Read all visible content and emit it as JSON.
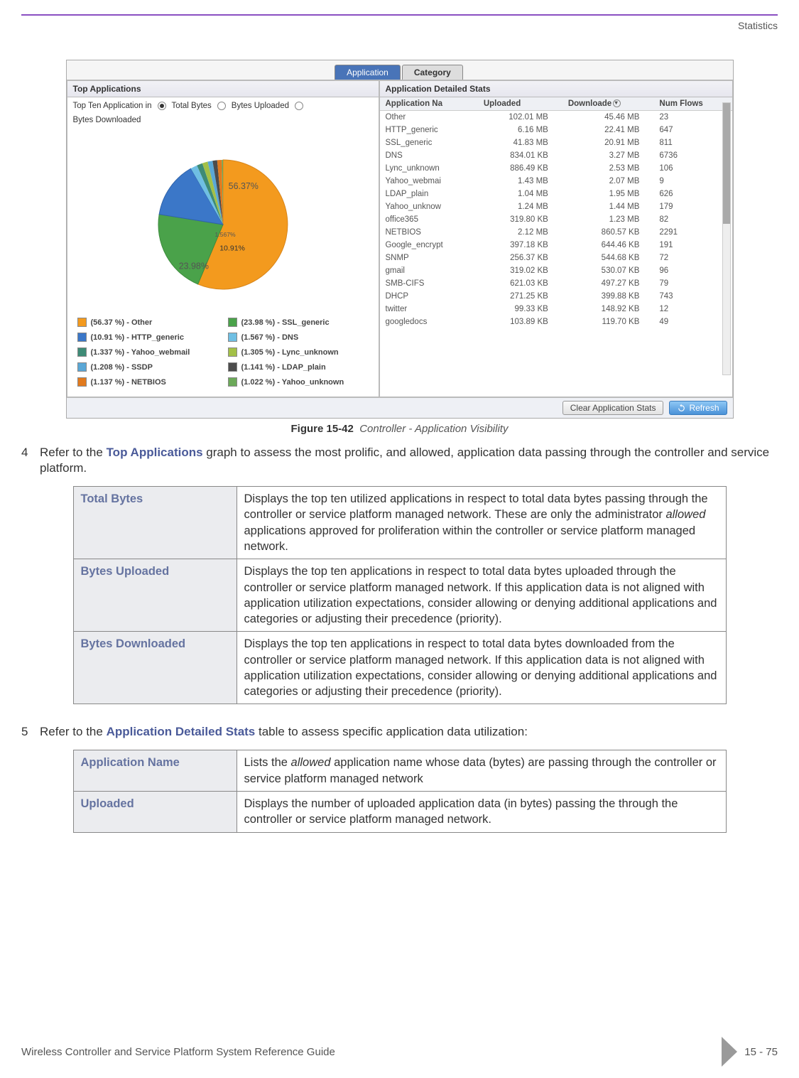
{
  "header": {
    "section": "Statistics"
  },
  "screenshot": {
    "tabs": {
      "active": "Application",
      "inactive": "Category"
    },
    "left_panel": {
      "title": "Top Applications",
      "radio_prefix": "Top Ten Application in",
      "radios": [
        {
          "label": "Total Bytes",
          "selected": true
        },
        {
          "label": "Bytes Uploaded",
          "selected": false
        },
        {
          "label": "Bytes Downloaded",
          "selected": false
        }
      ],
      "pie_labels": {
        "big": "56.37%",
        "mid2": "10.91%",
        "mid": "23.98%",
        "small": "1.567%"
      },
      "legend": [
        {
          "color": "#f39a1e",
          "text": "(56.37 %) - Other"
        },
        {
          "color": "#4aa24a",
          "text": "(23.98 %) - SSL_generic"
        },
        {
          "color": "#3b77c8",
          "text": "(10.91 %) - HTTP_generic"
        },
        {
          "color": "#6fbfe3",
          "text": "(1.567 %) - DNS"
        },
        {
          "color": "#3e8b76",
          "text": "(1.337 %) - Yahoo_webmail"
        },
        {
          "color": "#a3c047",
          "text": "(1.305 %) - Lync_unknown"
        },
        {
          "color": "#5aa7d6",
          "text": "(1.208 %) - SSDP"
        },
        {
          "color": "#4c4c4c",
          "text": "(1.141 %) - LDAP_plain"
        },
        {
          "color": "#e17a1e",
          "text": "(1.137 %) - NETBIOS"
        },
        {
          "color": "#6ca959",
          "text": "(1.022 %) - Yahoo_unknown"
        }
      ]
    },
    "right_panel": {
      "title": "Application Detailed Stats",
      "columns": [
        "Application Na",
        "Uploaded",
        "Downloade",
        "Num Flows"
      ],
      "rows": [
        [
          "Other",
          "102.01 MB",
          "45.46 MB",
          "23"
        ],
        [
          "HTTP_generic",
          "6.16 MB",
          "22.41 MB",
          "647"
        ],
        [
          "SSL_generic",
          "41.83 MB",
          "20.91 MB",
          "811"
        ],
        [
          "DNS",
          "834.01 KB",
          "3.27 MB",
          "6736"
        ],
        [
          "Lync_unknown",
          "886.49 KB",
          "2.53 MB",
          "106"
        ],
        [
          "Yahoo_webmai",
          "1.43 MB",
          "2.07 MB",
          "9"
        ],
        [
          "LDAP_plain",
          "1.04 MB",
          "1.95 MB",
          "626"
        ],
        [
          "Yahoo_unknow",
          "1.24 MB",
          "1.44 MB",
          "179"
        ],
        [
          "office365",
          "319.80 KB",
          "1.23 MB",
          "82"
        ],
        [
          "NETBIOS",
          "2.12 MB",
          "860.57 KB",
          "2291"
        ],
        [
          "Google_encrypt",
          "397.18 KB",
          "644.46 KB",
          "191"
        ],
        [
          "SNMP",
          "256.37 KB",
          "544.68 KB",
          "72"
        ],
        [
          "gmail",
          "319.02 KB",
          "530.07 KB",
          "96"
        ],
        [
          "SMB-CIFS",
          "621.03 KB",
          "497.27 KB",
          "79"
        ],
        [
          "DHCP",
          "271.25 KB",
          "399.88 KB",
          "743"
        ],
        [
          "twitter",
          "99.33 KB",
          "148.92 KB",
          "12"
        ],
        [
          "googledocs",
          "103.89 KB",
          "119.70 KB",
          "49"
        ]
      ],
      "buttons": {
        "clear": "Clear Application Stats",
        "refresh": "Refresh"
      }
    }
  },
  "figure": {
    "label": "Figure 15-42",
    "caption": "Controller - Application Visibility"
  },
  "step4_pre": "Refer to the ",
  "step4_b": "Top Applications",
  "step4_post": " graph to assess the most prolific, and allowed, application data passing through the controller and service platform.",
  "table1": [
    {
      "k": "Total Bytes",
      "v": "Displays the top ten utilized applications in respect to total data bytes passing through the controller or service platform managed network. These are only the administrator allowed applications approved for proliferation within the controller or service platform managed network."
    },
    {
      "k": "Bytes Uploaded",
      "v": "Displays the top ten applications in respect to total data bytes uploaded through the controller or service platform managed network. If this application data is not aligned with application utilization expectations, consider allowing or denying additional applications and categories or adjusting their precedence (priority)."
    },
    {
      "k": "Bytes Downloaded",
      "v": "Displays the top ten applications in respect to total data bytes downloaded from the controller or service platform managed network. If this application data is not aligned with application utilization expectations, consider allowing or denying additional applications and categories or adjusting their precedence (priority)."
    }
  ],
  "step5_pre": "Refer to the ",
  "step5_b": "Application Detailed Stats",
  "step5_post": " table to assess specific application data utilization:",
  "table2": [
    {
      "k": "Application Name",
      "v": "Lists the allowed application name whose data (bytes) are passing through the controller or service platform managed network"
    },
    {
      "k": "Uploaded",
      "v": "Displays the number of uploaded application data (in bytes) passing the through the controller or service platform managed network."
    }
  ],
  "footer": {
    "left": "Wireless Controller and Service Platform System Reference Guide",
    "right": "15 - 75"
  },
  "chart_data": {
    "type": "pie",
    "title": "Top Ten Application in Total Bytes",
    "series": [
      {
        "name": "Other",
        "value": 56.37
      },
      {
        "name": "SSL_generic",
        "value": 23.98
      },
      {
        "name": "HTTP_generic",
        "value": 10.91
      },
      {
        "name": "DNS",
        "value": 1.567
      },
      {
        "name": "Yahoo_webmail",
        "value": 1.337
      },
      {
        "name": "Lync_unknown",
        "value": 1.305
      },
      {
        "name": "SSDP",
        "value": 1.208
      },
      {
        "name": "LDAP_plain",
        "value": 1.141
      },
      {
        "name": "NETBIOS",
        "value": 1.137
      },
      {
        "name": "Yahoo_unknown",
        "value": 1.022
      }
    ]
  }
}
